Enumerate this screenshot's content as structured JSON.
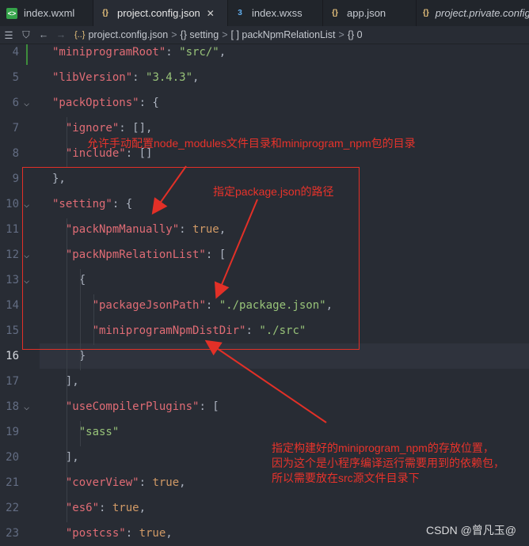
{
  "tabs": [
    {
      "label": "index.wxml",
      "icon": "wechat-file-icon",
      "active": false,
      "italic": false
    },
    {
      "label": "project.config.json",
      "icon": "braces-icon",
      "active": true,
      "italic": false
    },
    {
      "label": "index.wxss",
      "icon": "css-file-icon",
      "active": false,
      "italic": false
    },
    {
      "label": "app.json",
      "icon": "braces-icon",
      "active": false,
      "italic": false
    },
    {
      "label": "project.private.config.json",
      "icon": "braces-icon",
      "active": false,
      "italic": true
    }
  ],
  "breadcrumb": {
    "file": "project.config.json",
    "items": [
      "{} setting",
      "[ ] packNpmRelationList",
      "{} 0"
    ]
  },
  "lines": [
    {
      "n": "4",
      "fold": false,
      "text": "  \"miniprogramRoot\": \"src/\","
    },
    {
      "n": "5",
      "fold": false,
      "text": "  \"libVersion\": \"3.4.3\","
    },
    {
      "n": "6",
      "fold": true,
      "text": "  \"packOptions\": {"
    },
    {
      "n": "7",
      "fold": false,
      "text": "    \"ignore\": [],"
    },
    {
      "n": "8",
      "fold": false,
      "text": "    \"include\": []"
    },
    {
      "n": "9",
      "fold": false,
      "text": "  },"
    },
    {
      "n": "10",
      "fold": true,
      "text": "  \"setting\": {"
    },
    {
      "n": "11",
      "fold": false,
      "text": "    \"packNpmManually\": true,"
    },
    {
      "n": "12",
      "fold": true,
      "text": "    \"packNpmRelationList\": ["
    },
    {
      "n": "13",
      "fold": true,
      "text": "      {"
    },
    {
      "n": "14",
      "fold": false,
      "text": "        \"packageJsonPath\": \"./package.json\","
    },
    {
      "n": "15",
      "fold": false,
      "text": "        \"miniprogramNpmDistDir\": \"./src\""
    },
    {
      "n": "16",
      "fold": false,
      "text": "      }"
    },
    {
      "n": "17",
      "fold": false,
      "text": "    ],"
    },
    {
      "n": "18",
      "fold": true,
      "text": "    \"useCompilerPlugins\": ["
    },
    {
      "n": "19",
      "fold": false,
      "text": "      \"sass\""
    },
    {
      "n": "20",
      "fold": false,
      "text": "    ],"
    },
    {
      "n": "21",
      "fold": false,
      "text": "    \"coverView\": true,"
    },
    {
      "n": "22",
      "fold": false,
      "text": "    \"es6\": true,"
    },
    {
      "n": "23",
      "fold": false,
      "text": "    \"postcss\": true,"
    }
  ],
  "active_line": "16",
  "annotations": {
    "manual": "允许手动配置node_modules文件目录和miniprogram_npm包的目录",
    "path": "指定package.json的路径",
    "dist_1": "指定构建好的miniprogram_npm的存放位置，",
    "dist_2": "因为这个是小程序编译运行需要用到的依赖包，",
    "dist_3": "所以需要放在src源文件目录下"
  },
  "watermark": "CSDN @曾凡玉@",
  "colors": {
    "annotation": "#e8332b",
    "key": "#e06c75",
    "string": "#98c379",
    "literal": "#d19a66"
  }
}
